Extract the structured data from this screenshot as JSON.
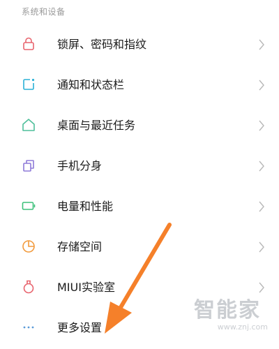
{
  "section_header": "系统和设备",
  "items": [
    {
      "label": "锁屏、密码和指纹",
      "icon": "lock-icon",
      "color": "#e8646e"
    },
    {
      "label": "通知和状态栏",
      "icon": "notification-icon",
      "color": "#2ab1d6"
    },
    {
      "label": "桌面与最近任务",
      "icon": "home-icon",
      "color": "#4fbf9b"
    },
    {
      "label": "手机分身",
      "icon": "dual-space-icon",
      "color": "#8e7ad8"
    },
    {
      "label": "电量和性能",
      "icon": "battery-icon",
      "color": "#3cc07a"
    },
    {
      "label": "存储空间",
      "icon": "storage-icon",
      "color": "#f29a3c"
    },
    {
      "label": "MIUI实验室",
      "icon": "lab-flask-icon",
      "color": "#e8646e"
    },
    {
      "label": "更多设置",
      "icon": "more-dots-icon",
      "color": "#5b9bd8"
    }
  ],
  "chevron_icon": "chevron-right-icon",
  "annotation_color": "#f5802a",
  "watermark": {
    "main": "智能家",
    "url": "www.znj.com"
  }
}
